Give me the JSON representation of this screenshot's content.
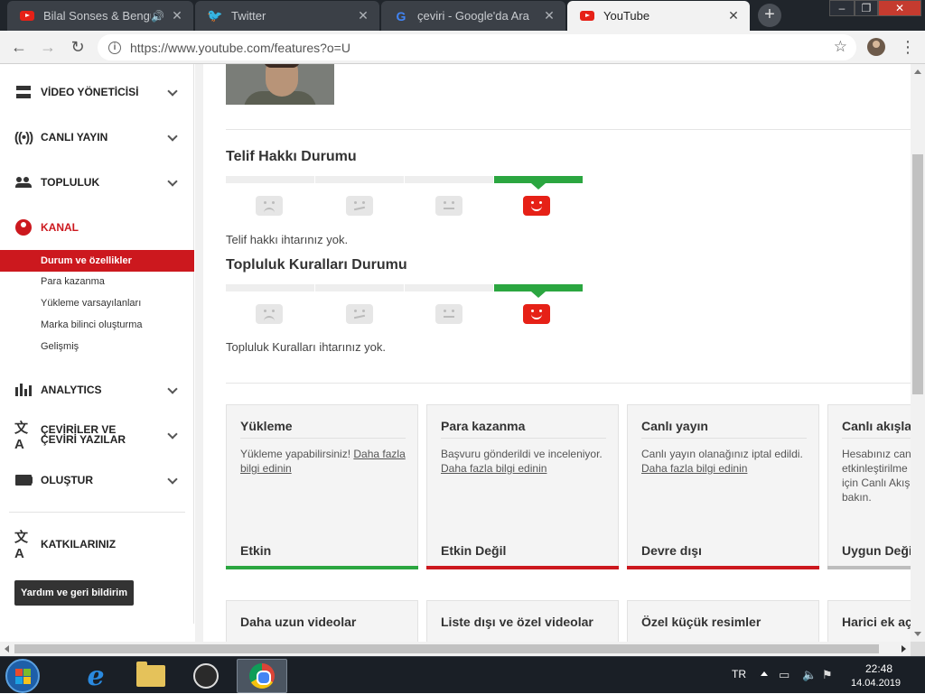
{
  "browser": {
    "tabs": [
      {
        "title": "Bilal Sonses & Bengü",
        "favicon": "youtube-icon",
        "audio": true,
        "active": false
      },
      {
        "title": "Twitter",
        "favicon": "twitter-icon",
        "active": false
      },
      {
        "title": "çeviri - Google'da Ara",
        "favicon": "google-icon",
        "active": false
      },
      {
        "title": "YouTube",
        "favicon": "youtube-icon",
        "active": true
      }
    ],
    "url": "https://www.youtube.com/features?o=U"
  },
  "sidebar": {
    "items": [
      {
        "label": "VİDEO YÖNETİCİSİ",
        "icon": "video-manager-icon"
      },
      {
        "label": "CANLI YAYIN",
        "icon": "live-icon"
      },
      {
        "label": "TOPLULUK",
        "icon": "community-icon"
      },
      {
        "label": "KANAL",
        "icon": "account-icon"
      },
      {
        "label": "ANALYTICS",
        "icon": "analytics-icon"
      },
      {
        "label": "ÇEVİRİLER VE ÇEVİRİ YAZILAR",
        "icon": "translate-icon"
      },
      {
        "label": "OLUŞTUR",
        "icon": "camera-icon"
      }
    ],
    "channel_subitems": [
      "Durum ve özellikler",
      "Para kazanma",
      "Yükleme varsayılanları",
      "Marka bilinci oluşturma",
      "Gelişmiş"
    ],
    "active_subitem": "Durum ve özellikler",
    "contributions": "KATKILARINIZ",
    "help_button": "Yardım ve geri bildirim",
    "accent_color": "#cc181e"
  },
  "main": {
    "copyright": {
      "title": "Telif Hakkı Durumu",
      "note": "Telif hakkı ihtarınız yok.",
      "level_active": 4,
      "level_count": 4
    },
    "community": {
      "title": "Topluluk Kuralları Durumu",
      "note": "Topluluk Kuralları ihtarınız yok.",
      "level_active": 4,
      "level_count": 4
    },
    "cards": [
      {
        "title": "Yükleme",
        "text": "Yükleme yapabilirsiniz! ",
        "link": "Daha fazla bilgi edinin",
        "status": "Etkin",
        "bar_color": "#2ba640"
      },
      {
        "title": "Para kazanma",
        "text": "Başvuru gönderildi ve inceleniyor. ",
        "link": "Daha fazla bilgi edinin",
        "status": "Etkin Değil",
        "bar_color": "#cc181e"
      },
      {
        "title": "Canlı yayın",
        "text": "Canlı yayın olanağınız iptal edildi. ",
        "link": "Daha fazla bilgi edinin",
        "status": "Devre dışı",
        "bar_color": "#cc181e"
      },
      {
        "title": "Canlı akışlar",
        "text": "Hesabınız can etkinleştirilme için Canlı Akış bakın.",
        "link": "",
        "status": "Uygun Değil",
        "bar_color": "#bdbdbd"
      }
    ],
    "cards_row2": [
      "Daha uzun videolar",
      "Liste dışı ve özel videolar",
      "Özel küçük resimler",
      "Harici ek aç"
    ]
  },
  "taskbar": {
    "language": "TR",
    "time": "22:48",
    "date": "14.04.2019"
  }
}
